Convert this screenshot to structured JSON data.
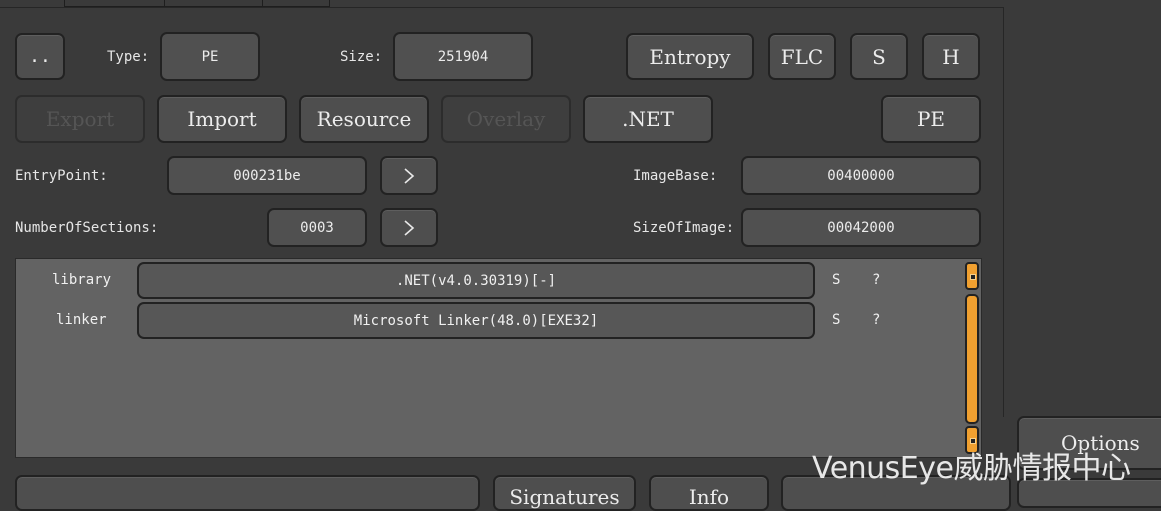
{
  "header": {
    "back_label": "..",
    "type_label": "Type:",
    "type_value": "PE",
    "size_label": "Size:",
    "size_value": "251904",
    "entropy_label": "Entropy",
    "flc_label": "FLC",
    "s_label": "S",
    "h_label": "H"
  },
  "toolbar": {
    "export_label": "Export",
    "import_label": "Import",
    "resource_label": "Resource",
    "overlay_label": "Overlay",
    "net_label": ".NET",
    "pe_label": "PE"
  },
  "fields": {
    "entrypoint_label": "EntryPoint:",
    "entrypoint_value": "000231be",
    "numberofsections_label": "NumberOfSections:",
    "numberofsections_value": "0003",
    "imagebase_label": "ImageBase:",
    "imagebase_value": "00400000",
    "sizeofimage_label": "SizeOfImage:",
    "sizeofimage_value": "00042000"
  },
  "detections": [
    {
      "type": "library",
      "name": ".NET(v4.0.30319)[-]",
      "s": "S",
      "q": "?"
    },
    {
      "type": "linker",
      "name": "Microsoft Linker(48.0)[EXE32]",
      "s": "S",
      "q": "?"
    }
  ],
  "side": {
    "options_label": "Options"
  },
  "bottom": {
    "btn1_label": "",
    "btn2_label": "Signatures",
    "btn3_label": "Info",
    "btn4_label": ""
  },
  "watermark": "VenusEye威胁情报中心"
}
